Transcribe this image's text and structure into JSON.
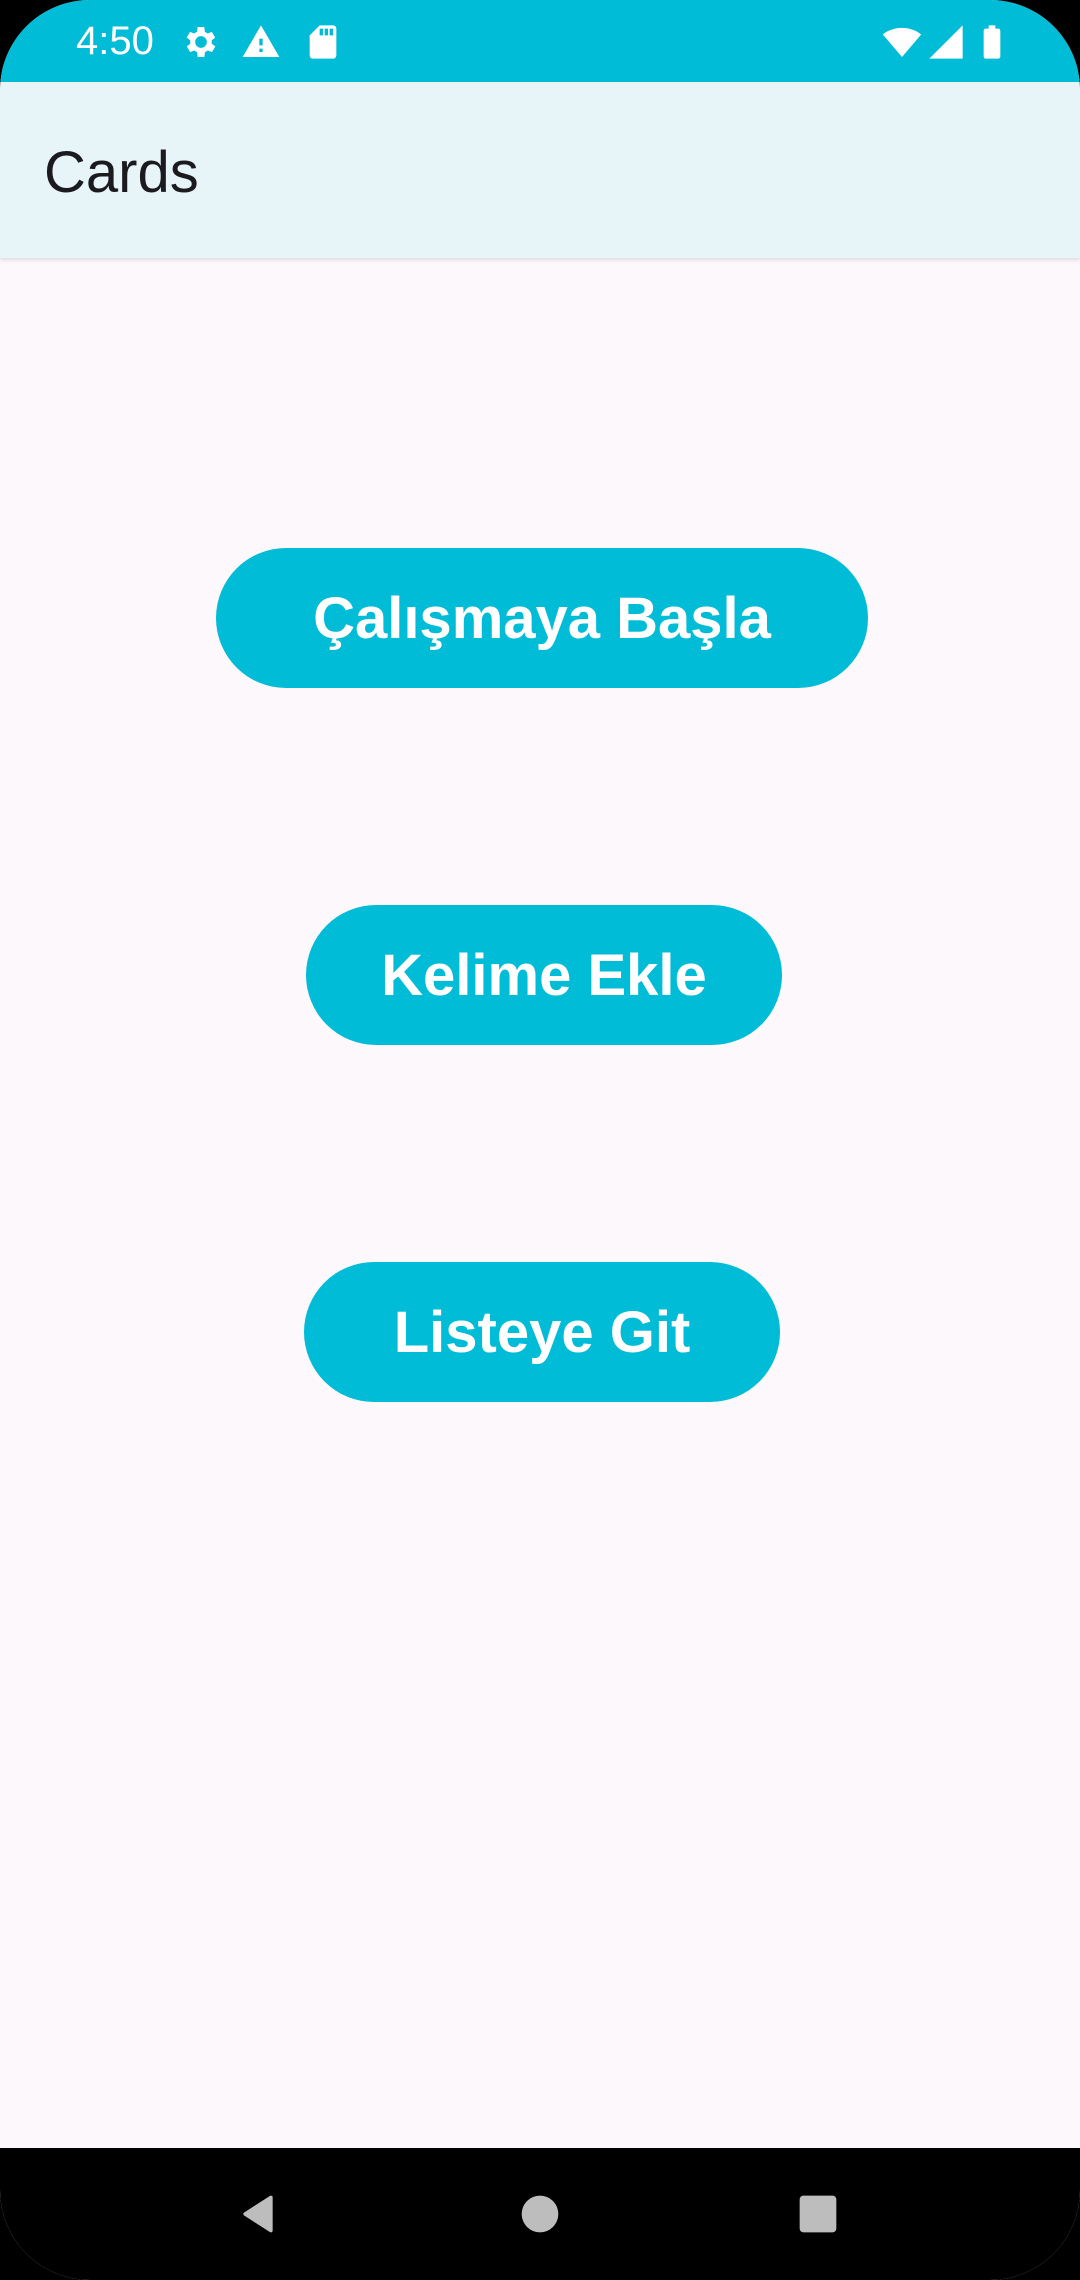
{
  "status_bar": {
    "time": "4:50",
    "left_icons": [
      "settings-icon",
      "warning-icon",
      "sd-card-icon"
    ],
    "right_icons": [
      "wifi-icon",
      "cell-signal-icon",
      "battery-icon"
    ],
    "color": "#00bcd6"
  },
  "app_bar": {
    "title": "Cards",
    "background": "#e7f5f9"
  },
  "main": {
    "buttons": [
      {
        "label": "Çalışmaya Başla"
      },
      {
        "label": "Kelime Ekle"
      },
      {
        "label": "Listeye Git"
      }
    ],
    "accent": "#00bcd6",
    "background": "#fdf8fb"
  },
  "nav_bar": {
    "items": [
      "back-icon",
      "home-icon",
      "recents-icon"
    ]
  }
}
